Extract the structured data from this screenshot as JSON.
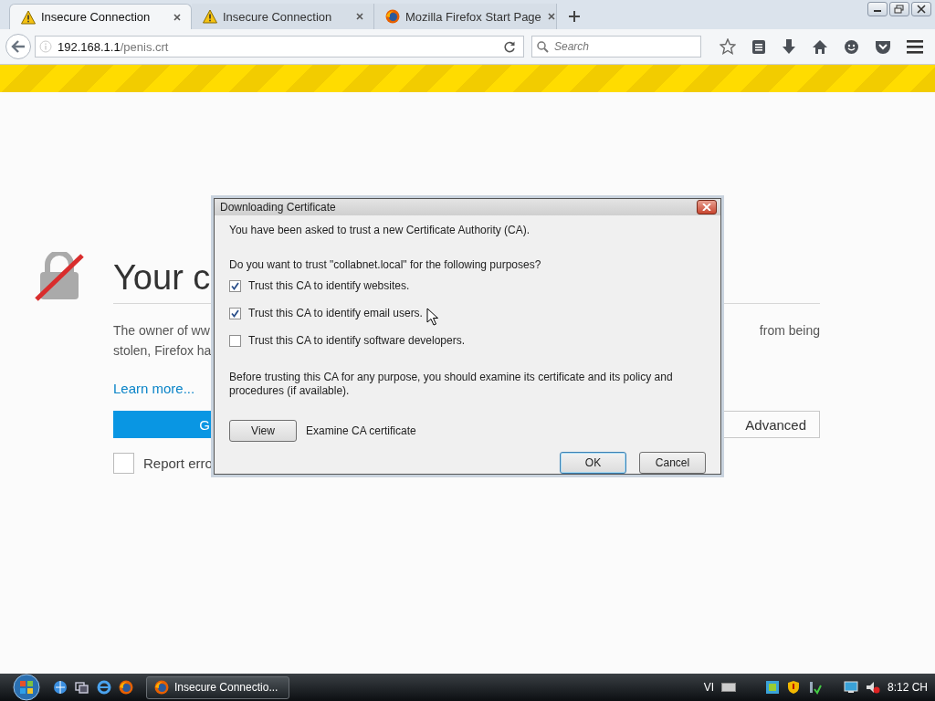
{
  "tabs": [
    {
      "title": "Insecure Connection",
      "kind": "warning",
      "selected": true
    },
    {
      "title": "Insecure Connection",
      "kind": "warning",
      "selected": false
    },
    {
      "title": "Mozilla Firefox Start Page",
      "kind": "firefox",
      "selected": false
    }
  ],
  "address_bar": {
    "host": "192.168.1.1",
    "path": "/penis.crt"
  },
  "search": {
    "placeholder": "Search"
  },
  "page": {
    "heading": "Your c",
    "paragraph_line_1": "The owner of ww",
    "paragraph_line_1_end": "from being",
    "paragraph_line_2": "stolen, Firefox ha",
    "learn_more": "Learn more...",
    "primary_button": "G",
    "advanced_button": "Advanced",
    "report_checkbox": {
      "label": "Report erro",
      "checked": false
    }
  },
  "dialog": {
    "title": "Downloading Certificate",
    "intro": "You have been asked to trust a new Certificate Authority (CA).",
    "question": "Do you want to trust \"collabnet.local\" for the following purposes?",
    "options": [
      {
        "label": "Trust this CA to identify websites.",
        "checked": true
      },
      {
        "label": "Trust this CA to identify email users.",
        "checked": true
      },
      {
        "label": "Trust this CA to identify software developers.",
        "checked": false
      }
    ],
    "note": "Before trusting this CA for any purpose, you should examine its certificate and its policy and procedures (if available).",
    "view_button": "View",
    "view_label": "Examine CA certificate",
    "buttons": [
      {
        "label": "OK",
        "default": true
      },
      {
        "label": "Cancel",
        "default": false
      }
    ]
  },
  "taskbar": {
    "task": "Insecure Connectio...",
    "language": "VI",
    "clock": "8:12 CH"
  }
}
